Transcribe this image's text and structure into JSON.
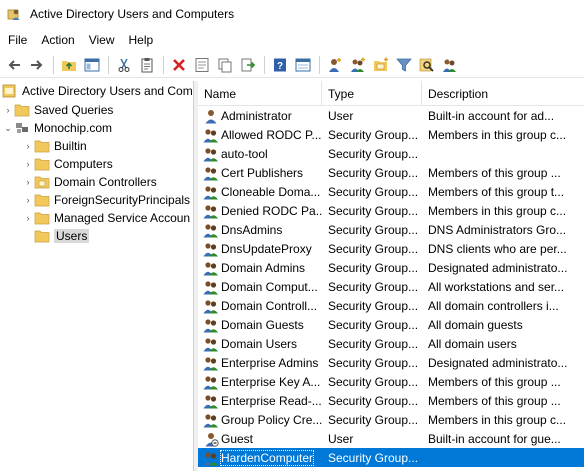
{
  "window": {
    "title": "Active Directory Users and Computers"
  },
  "menu": [
    "File",
    "Action",
    "View",
    "Help"
  ],
  "toolbar": [
    "back-icon",
    "forward-icon",
    "sep",
    "up-folder-icon",
    "show-console-tree-icon",
    "sep",
    "cut-icon",
    "clipboard-icon",
    "sep",
    "delete-icon",
    "properties-icon",
    "copy-icon",
    "export-icon",
    "sep",
    "help-icon",
    "console-view-icon",
    "sep",
    "new-user-icon",
    "new-group-icon",
    "new-ou-icon",
    "filter-icon",
    "find-icon",
    "add-to-group-icon"
  ],
  "tree": {
    "root": "Active Directory Users and Com",
    "saved_queries": "Saved Queries",
    "domain": "Monochip.com",
    "items": [
      "Builtin",
      "Computers",
      "Domain Controllers",
      "ForeignSecurityPrincipals",
      "Managed Service Accoun",
      "Users"
    ]
  },
  "columns": {
    "name": "Name",
    "type": "Type",
    "desc": "Description"
  },
  "rows": [
    {
      "name": "Administrator",
      "type": "User",
      "desc": "Built-in account for ad...",
      "icon": "user"
    },
    {
      "name": "Allowed RODC P...",
      "type": "Security Group...",
      "desc": "Members in this group c...",
      "icon": "group"
    },
    {
      "name": "auto-tool",
      "type": "Security Group...",
      "desc": "",
      "icon": "group"
    },
    {
      "name": "Cert Publishers",
      "type": "Security Group...",
      "desc": "Members of this group ...",
      "icon": "group"
    },
    {
      "name": "Cloneable Doma...",
      "type": "Security Group...",
      "desc": "Members of this group t...",
      "icon": "group"
    },
    {
      "name": "Denied RODC Pa...",
      "type": "Security Group...",
      "desc": "Members in this group c...",
      "icon": "group"
    },
    {
      "name": "DnsAdmins",
      "type": "Security Group...",
      "desc": "DNS Administrators Gro...",
      "icon": "group"
    },
    {
      "name": "DnsUpdateProxy",
      "type": "Security Group...",
      "desc": "DNS clients who are per...",
      "icon": "group"
    },
    {
      "name": "Domain Admins",
      "type": "Security Group...",
      "desc": "Designated administrato...",
      "icon": "group"
    },
    {
      "name": "Domain Comput...",
      "type": "Security Group...",
      "desc": "All workstations and ser...",
      "icon": "group"
    },
    {
      "name": "Domain Controll...",
      "type": "Security Group...",
      "desc": "All domain controllers i...",
      "icon": "group"
    },
    {
      "name": "Domain Guests",
      "type": "Security Group...",
      "desc": "All domain guests",
      "icon": "group"
    },
    {
      "name": "Domain Users",
      "type": "Security Group...",
      "desc": "All domain users",
      "icon": "group"
    },
    {
      "name": "Enterprise Admins",
      "type": "Security Group...",
      "desc": "Designated administrato...",
      "icon": "group"
    },
    {
      "name": "Enterprise Key A...",
      "type": "Security Group...",
      "desc": "Members of this group ...",
      "icon": "group"
    },
    {
      "name": "Enterprise Read-...",
      "type": "Security Group...",
      "desc": "Members of this group ...",
      "icon": "group"
    },
    {
      "name": "Group Policy Cre...",
      "type": "Security Group...",
      "desc": "Members in this group c...",
      "icon": "group"
    },
    {
      "name": "Guest",
      "type": "User",
      "desc": "Built-in account for gue...",
      "icon": "user-disabled"
    },
    {
      "name": "HardenComputer",
      "type": "Security Group...",
      "desc": "",
      "icon": "group",
      "selected": true
    }
  ],
  "colors": {
    "selection": "#0078d7",
    "folder": "#f2c75c",
    "group_blue": "#3a6db5"
  }
}
